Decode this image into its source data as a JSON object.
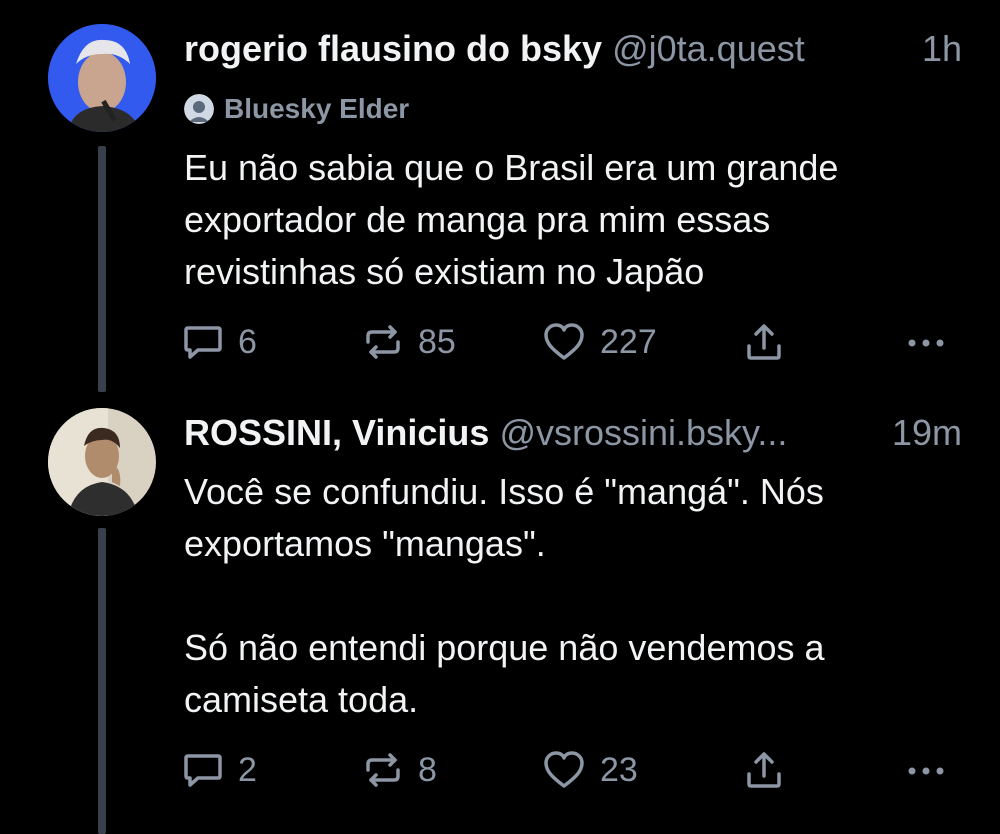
{
  "posts": [
    {
      "display_name": "rogerio flausino do bsky",
      "handle": "@j0ta.quest",
      "time": "1h",
      "badge": "Bluesky Elder",
      "text": "Eu não sabia que o Brasil era um grande\nexportador de manga pra mim essas\nrevistinhas só existiam no Japão",
      "replies": "6",
      "reposts": "85",
      "likes": "227"
    },
    {
      "display_name": "ROSSINI, Vinicius",
      "handle": "@vsrossini.bsky...",
      "time": "19m",
      "text": "Você se confundiu. Isso é \"mangá\". Nós\nexportamos \"mangas\".\n\nSó não entendi porque não vendemos a\ncamiseta toda.",
      "replies": "2",
      "reposts": "8",
      "likes": "23"
    }
  ],
  "icons": {
    "reply": "reply-icon",
    "repost": "repost-icon",
    "like": "heart-icon",
    "share": "share-icon",
    "more": "more-icon"
  },
  "colors": {
    "background": "#000000",
    "text": "#f1f3f5",
    "muted": "#8c96a4",
    "thread_line": "#38414b"
  }
}
